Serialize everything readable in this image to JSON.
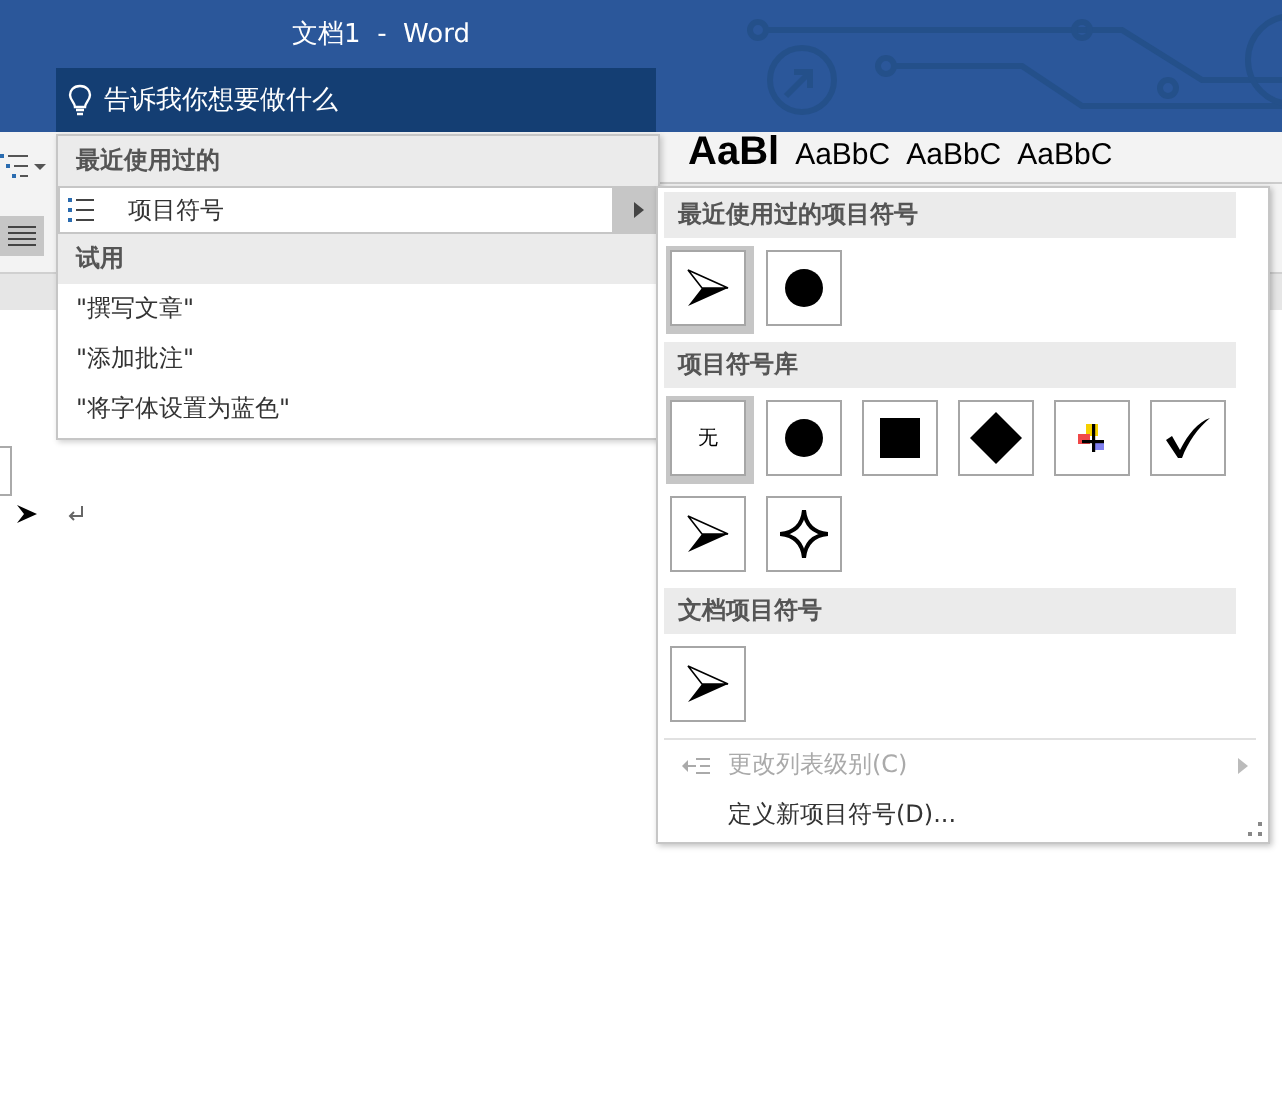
{
  "window": {
    "title": "文档1  -  Word"
  },
  "tell_me": {
    "placeholder": "告诉我你想要做什么"
  },
  "styles_gallery": [
    "AaBl",
    "AaBbC",
    "AaBbC",
    "AaBbC"
  ],
  "tell_me_menu": {
    "sections": [
      {
        "heading": "最近使用过的",
        "items": [
          {
            "label": "项目符号",
            "has_submenu": true,
            "selected": true
          }
        ]
      },
      {
        "heading": "试用",
        "items": [
          {
            "label": "\"撰写文章\"",
            "has_submenu": false,
            "selected": false
          },
          {
            "label": "\"添加批注\"",
            "has_submenu": false,
            "selected": false
          },
          {
            "label": "\"将字体设置为蓝色\"",
            "has_submenu": false,
            "selected": false
          }
        ]
      }
    ]
  },
  "bullet_menu": {
    "groups": [
      {
        "heading": "最近使用过的项目符号",
        "bullets": [
          {
            "kind": "arrowhead",
            "selected": true
          },
          {
            "kind": "circle",
            "selected": false
          }
        ]
      },
      {
        "heading": "项目符号库",
        "bullets": [
          {
            "kind": "none",
            "label": "无",
            "selected": true
          },
          {
            "kind": "circle",
            "selected": false
          },
          {
            "kind": "square",
            "selected": false
          },
          {
            "kind": "diamond",
            "selected": false
          },
          {
            "kind": "plus",
            "selected": false
          },
          {
            "kind": "check",
            "selected": false
          },
          {
            "kind": "arrowhead",
            "selected": false
          },
          {
            "kind": "star",
            "selected": false
          }
        ]
      },
      {
        "heading": "文档项目符号",
        "bullets": [
          {
            "kind": "arrowhead",
            "selected": false
          }
        ]
      }
    ],
    "commands": [
      {
        "label": "更改列表级别(C)",
        "disabled": true,
        "has_submenu": true,
        "icon": true
      },
      {
        "label": "定义新项目符号(D)...",
        "disabled": false,
        "has_submenu": false,
        "icon": false
      }
    ]
  }
}
